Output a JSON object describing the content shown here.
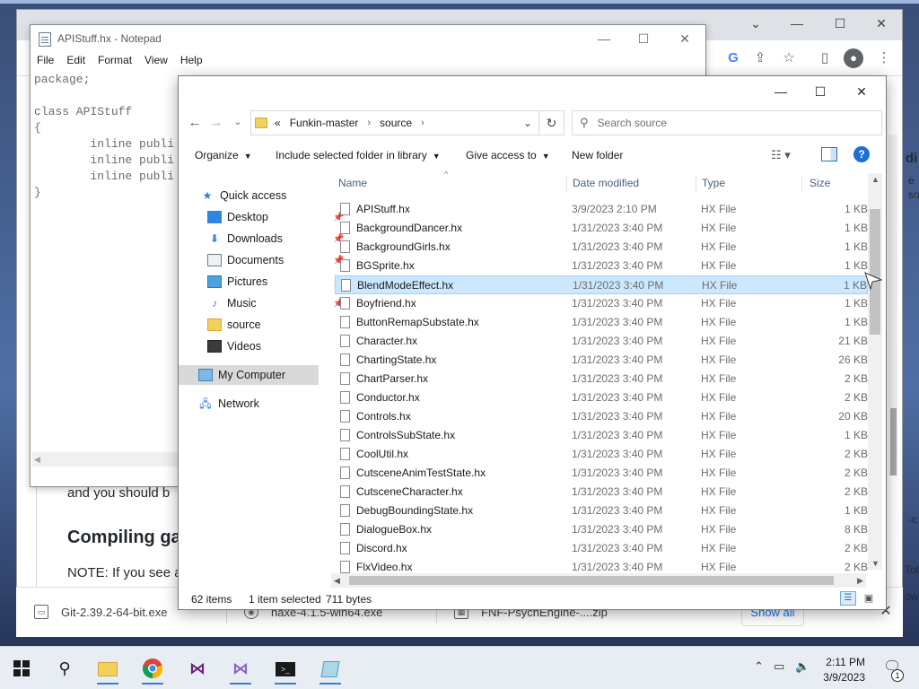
{
  "notepad": {
    "title": "APIStuff.hx - Notepad",
    "menu": [
      "File",
      "Edit",
      "Format",
      "View",
      "Help"
    ],
    "text_lines": [
      "package;",
      "",
      "class APIStuff",
      "{",
      "        inline publi",
      "        inline publi",
      "        inline publi",
      "}"
    ]
  },
  "browser_page": {
    "frag_should": "and you should b",
    "frag_compiling": "Compiling ga",
    "frag_note": "NOTE: If you see a",
    "frag_r1": "di",
    "frag_r2": "e",
    "frag_r3": "so",
    "frag_r4": "-c",
    "frag_r5": "Tot",
    "frag_r6": "ow"
  },
  "downloads": {
    "items": [
      "Git-2.39.2-64-bit.exe",
      "haxe-4.1.5-win64.exe",
      "FNF-PsychEngine-....zip"
    ],
    "show_all": "Show all"
  },
  "explorer": {
    "breadcrumb": [
      "Funkin-master",
      "source"
    ],
    "breadcrumb_prefix": "«",
    "search_placeholder": "Search source",
    "commands": [
      "Organize",
      "Include selected folder in library",
      "Give access to",
      "New folder"
    ],
    "nav": {
      "quick_access": "Quick access",
      "items": [
        "Desktop",
        "Downloads",
        "Documents",
        "Pictures",
        "Music",
        "source",
        "Videos"
      ],
      "my_computer": "My Computer",
      "network": "Network"
    },
    "columns": [
      "Name",
      "Date modified",
      "Type",
      "Size"
    ],
    "files": [
      {
        "name": "APIStuff.hx",
        "date": "3/9/2023 2:10 PM",
        "type": "HX File",
        "size": "1 KB"
      },
      {
        "name": "BackgroundDancer.hx",
        "date": "1/31/2023 3:40 PM",
        "type": "HX File",
        "size": "1 KB"
      },
      {
        "name": "BackgroundGirls.hx",
        "date": "1/31/2023 3:40 PM",
        "type": "HX File",
        "size": "1 KB"
      },
      {
        "name": "BGSprite.hx",
        "date": "1/31/2023 3:40 PM",
        "type": "HX File",
        "size": "1 KB"
      },
      {
        "name": "BlendModeEffect.hx",
        "date": "1/31/2023 3:40 PM",
        "type": "HX File",
        "size": "1 KB",
        "selected": true
      },
      {
        "name": "Boyfriend.hx",
        "date": "1/31/2023 3:40 PM",
        "type": "HX File",
        "size": "1 KB"
      },
      {
        "name": "ButtonRemapSubstate.hx",
        "date": "1/31/2023 3:40 PM",
        "type": "HX File",
        "size": "1 KB"
      },
      {
        "name": "Character.hx",
        "date": "1/31/2023 3:40 PM",
        "type": "HX File",
        "size": "21 KB"
      },
      {
        "name": "ChartingState.hx",
        "date": "1/31/2023 3:40 PM",
        "type": "HX File",
        "size": "26 KB"
      },
      {
        "name": "ChartParser.hx",
        "date": "1/31/2023 3:40 PM",
        "type": "HX File",
        "size": "2 KB"
      },
      {
        "name": "Conductor.hx",
        "date": "1/31/2023 3:40 PM",
        "type": "HX File",
        "size": "2 KB"
      },
      {
        "name": "Controls.hx",
        "date": "1/31/2023 3:40 PM",
        "type": "HX File",
        "size": "20 KB"
      },
      {
        "name": "ControlsSubState.hx",
        "date": "1/31/2023 3:40 PM",
        "type": "HX File",
        "size": "1 KB"
      },
      {
        "name": "CoolUtil.hx",
        "date": "1/31/2023 3:40 PM",
        "type": "HX File",
        "size": "2 KB"
      },
      {
        "name": "CutsceneAnimTestState.hx",
        "date": "1/31/2023 3:40 PM",
        "type": "HX File",
        "size": "2 KB"
      },
      {
        "name": "CutsceneCharacter.hx",
        "date": "1/31/2023 3:40 PM",
        "type": "HX File",
        "size": "2 KB"
      },
      {
        "name": "DebugBoundingState.hx",
        "date": "1/31/2023 3:40 PM",
        "type": "HX File",
        "size": "1 KB"
      },
      {
        "name": "DialogueBox.hx",
        "date": "1/31/2023 3:40 PM",
        "type": "HX File",
        "size": "8 KB"
      },
      {
        "name": "Discord.hx",
        "date": "1/31/2023 3:40 PM",
        "type": "HX File",
        "size": "2 KB"
      },
      {
        "name": "FlxVideo.hx",
        "date": "1/31/2023 3:40 PM",
        "type": "HX File",
        "size": "2 KB"
      }
    ],
    "status": {
      "items": "62 items",
      "selected": "1 item selected",
      "size": "711 bytes"
    }
  },
  "taskbar": {
    "time": "2:11 PM",
    "date": "3/9/2023",
    "notification_count": "1"
  },
  "colors": {
    "selection_bg": "#cce8ff",
    "accent": "#1f6fd1"
  }
}
